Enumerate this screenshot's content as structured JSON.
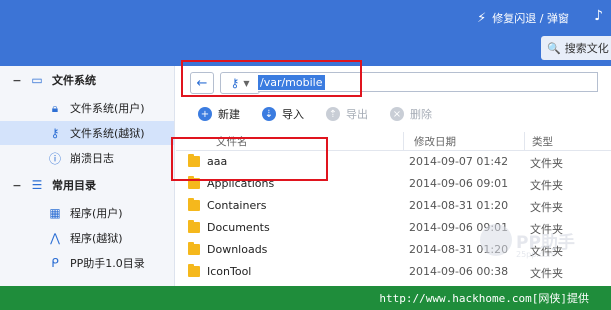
{
  "header": {
    "repair_label": "修复闪退 / 弹窗",
    "search_placeholder": "搜索文化"
  },
  "sidebar": {
    "sections": [
      {
        "title": "文件系统",
        "items": [
          {
            "label": "文件系统(用户)",
            "icon": "lock-icon"
          },
          {
            "label": "文件系统(越狱)",
            "icon": "key-icon",
            "selected": true
          },
          {
            "label": "崩溃日志",
            "icon": "info-icon"
          }
        ]
      },
      {
        "title": "常用目录",
        "items": [
          {
            "label": "程序(用户)",
            "icon": "apps-grid-icon"
          },
          {
            "label": "程序(越狱)",
            "icon": "compass-icon"
          },
          {
            "label": "PP助手1.0目录",
            "icon": "pp-icon"
          }
        ]
      }
    ]
  },
  "address": {
    "path": "/var/mobile"
  },
  "toolbar": {
    "new_label": "新建",
    "import_label": "导入",
    "export_label": "导出",
    "delete_label": "删除"
  },
  "table": {
    "headers": {
      "name": "文件名",
      "date": "修改日期",
      "type": "类型"
    },
    "rows": [
      {
        "name": "aaa",
        "date": "2014-09-07 01:42",
        "type": "文件夹"
      },
      {
        "name": "Applications",
        "date": "2014-09-06 09:01",
        "type": "文件夹"
      },
      {
        "name": "Containers",
        "date": "2014-08-31 01:20",
        "type": "文件夹"
      },
      {
        "name": "Documents",
        "date": "2014-09-06 09:01",
        "type": "文件夹"
      },
      {
        "name": "Downloads",
        "date": "2014-08-31 01:20",
        "type": "文件夹"
      },
      {
        "name": "IconTool",
        "date": "2014-09-06 00:38",
        "type": "文件夹"
      }
    ]
  },
  "watermark": {
    "text": "PP助手",
    "url": "25pp.com"
  },
  "footer": {
    "text": "http://www.hackhome.com[网侠]提供"
  },
  "colors": {
    "accent": "#3c74d6",
    "footer": "#1f8d3b",
    "highlight": "#e0141e"
  }
}
